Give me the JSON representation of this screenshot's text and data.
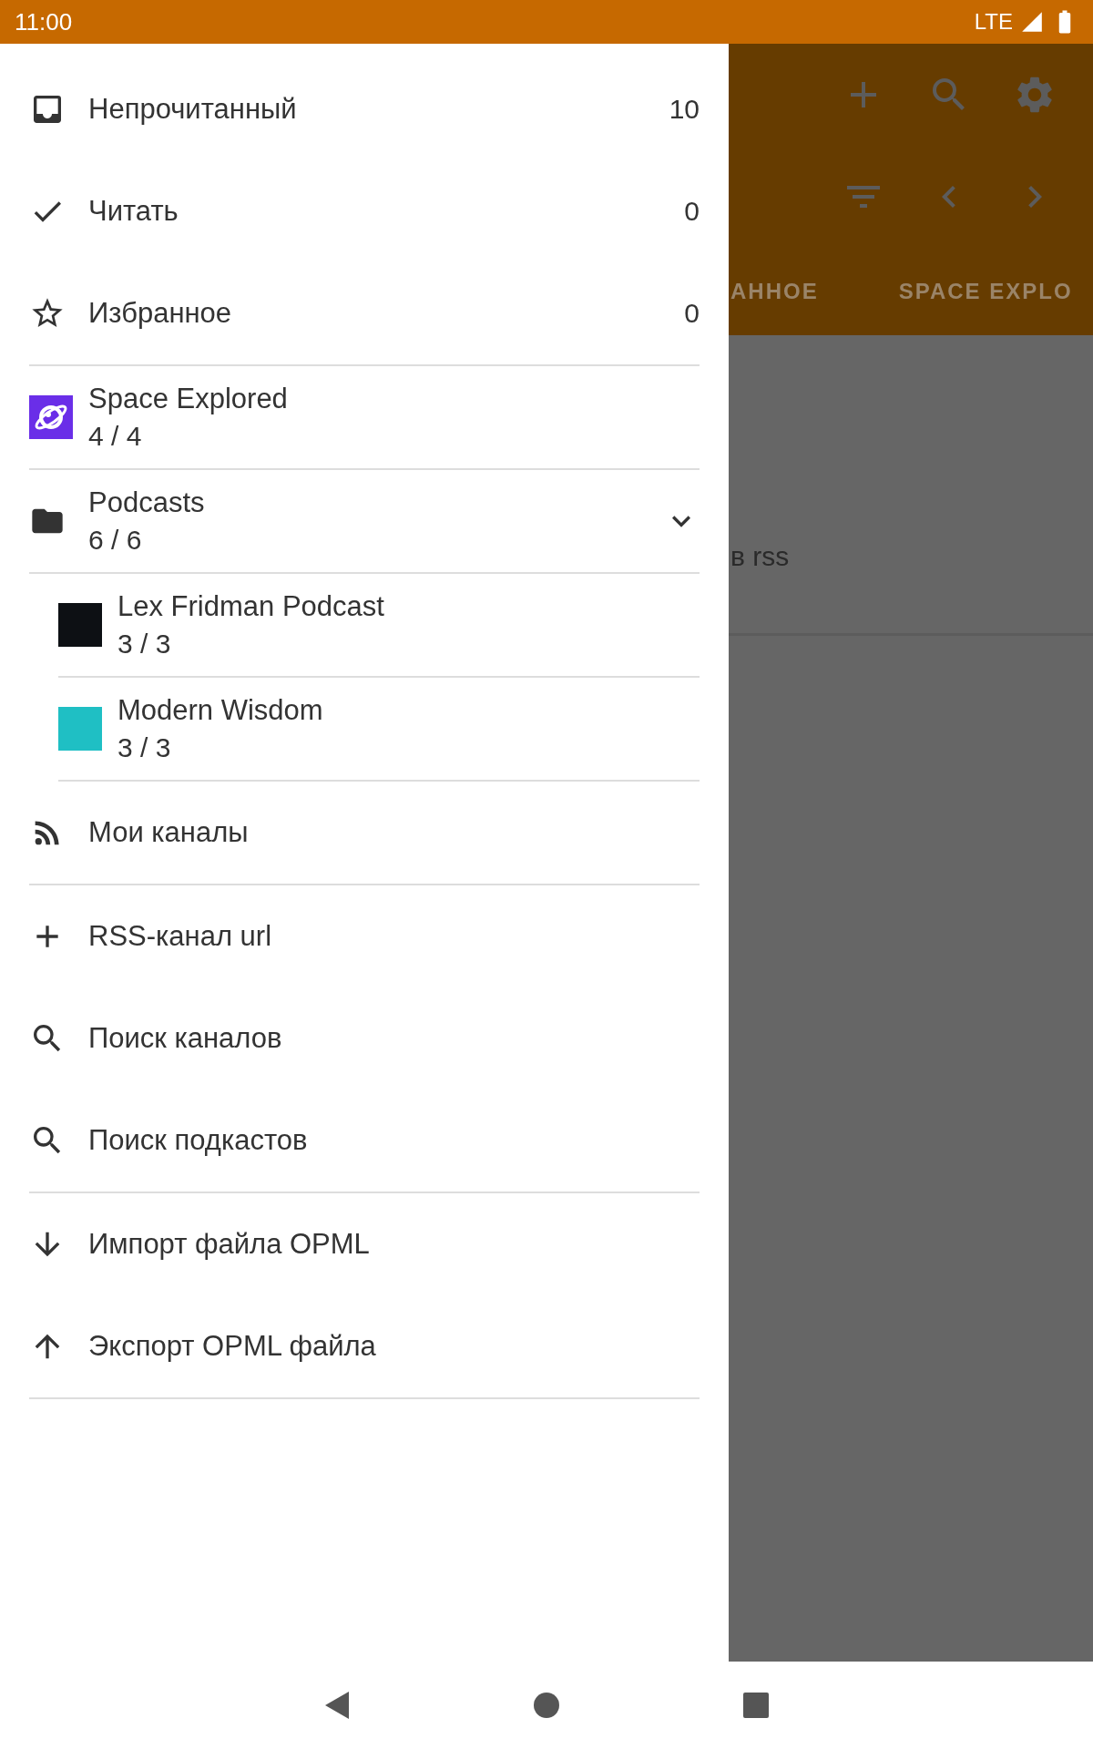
{
  "status_bar": {
    "time": "11:00",
    "network": "LTE"
  },
  "background_app": {
    "tabs": [
      {
        "label": "АННОЕ"
      },
      {
        "label": "SPACE EXPLO"
      }
    ],
    "content_text": "в rss"
  },
  "drawer": {
    "sections": [
      {
        "items": [
          {
            "kind": "nav",
            "label": "Непрочитанный",
            "count": "10"
          },
          {
            "kind": "nav",
            "label": "Читать",
            "count": "0"
          },
          {
            "kind": "nav",
            "label": "Избранное",
            "count": "0"
          }
        ]
      },
      {
        "items": [
          {
            "kind": "feed",
            "title": "Space Explored",
            "counts": "4 / 4"
          },
          {
            "kind": "folder",
            "title": "Podcasts",
            "counts": "6 / 6",
            "expanded": true,
            "children": [
              {
                "title": "Lex Fridman Podcast",
                "counts": "3 / 3"
              },
              {
                "title": "Modern Wisdom",
                "counts": "3 / 3"
              }
            ]
          }
        ]
      },
      {
        "items": [
          {
            "kind": "nav",
            "label": "Мои каналы"
          }
        ]
      },
      {
        "items": [
          {
            "kind": "nav",
            "label": "RSS-канал url"
          },
          {
            "kind": "nav",
            "label": "Поиск каналов"
          },
          {
            "kind": "nav",
            "label": "Поиск подкастов"
          }
        ]
      },
      {
        "items": [
          {
            "kind": "nav",
            "label": "Импорт файла OPML"
          },
          {
            "kind": "nav",
            "label": "Экспорт OPML файла"
          }
        ]
      }
    ]
  }
}
